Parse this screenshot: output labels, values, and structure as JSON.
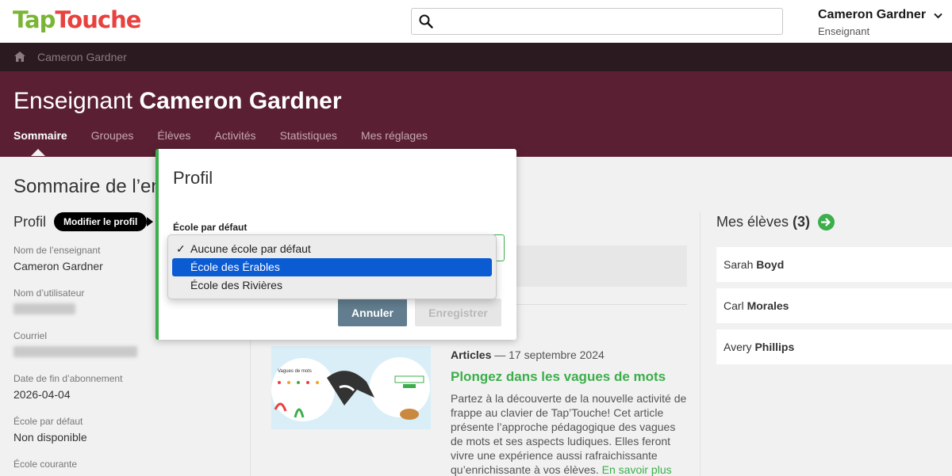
{
  "header": {
    "logo_part1": "Tap",
    "logo_part2": "Touche",
    "search_placeholder": "",
    "user_name": "Cameron Gardner",
    "user_role": "Enseignant"
  },
  "breadcrumb": {
    "item": "Cameron Gardner"
  },
  "hero": {
    "title_prefix": "Enseignant",
    "title_name": "Cameron Gardner",
    "tabs": [
      "Sommaire",
      "Groupes",
      "Élèves",
      "Activités",
      "Statistiques",
      "Mes réglages"
    ]
  },
  "main": {
    "page_title": "Sommaire de l’ens",
    "profile_label": "Profil",
    "edit_profile_button": "Modifier le profil",
    "fields": [
      {
        "label": "Nom de l’enseignant",
        "value": "Cameron Gardner"
      },
      {
        "label": "Nom d’utilisateur",
        "value": ""
      },
      {
        "label": "Courriel",
        "value": ""
      },
      {
        "label": "Date de fin d’abonnement",
        "value": "2026-04-04"
      },
      {
        "label": "École par défaut",
        "value": "Non disponible"
      },
      {
        "label": "École courante",
        "value": ""
      }
    ]
  },
  "article": {
    "category": "Articles",
    "separator": " — ",
    "date": "17 septembre 2024",
    "title": "Plongez dans les vagues de mots",
    "body": "Partez à la découverte de la nouvelle activité de frappe au clavier de Tap’Touche! Cet article présente l’approche pédagogique des vagues de mots et ses aspects ludiques. Elles feront vivre une expérience aussi rafraichissante qu’enrichissante à vos élèves.",
    "link": "En savoir plus",
    "image_text": "Vagues de mots"
  },
  "students": {
    "title": "Mes élèves",
    "count": "(3)",
    "list": [
      {
        "first": "Sarah",
        "last": "Boyd"
      },
      {
        "first": "Carl",
        "last": "Morales"
      },
      {
        "first": "Avery",
        "last": "Phillips"
      }
    ]
  },
  "modal": {
    "title": "Profil",
    "field_label": "École par défaut",
    "options": [
      {
        "label": "Aucune école par défaut",
        "checked": true
      },
      {
        "label": "École des Érables",
        "highlighted": true
      },
      {
        "label": "École des Rivières"
      }
    ],
    "cancel_button": "Annuler",
    "save_button": "Enregistrer"
  },
  "colors": {
    "brand_dark": "#5a1f33",
    "accent_green": "#3cae4b",
    "select_blue": "#0b5bd3"
  }
}
